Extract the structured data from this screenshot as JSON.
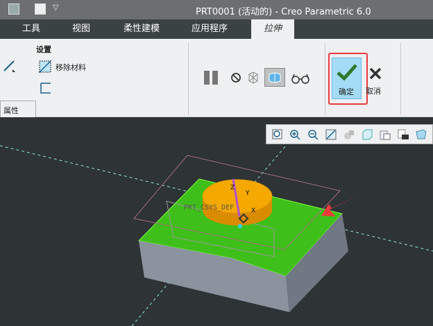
{
  "window": {
    "title": "PRT0001 (活动的) - Creo Parametric 6.0"
  },
  "tabs": [
    {
      "label": "工具"
    },
    {
      "label": "视图"
    },
    {
      "label": "柔性建模"
    },
    {
      "label": "应用程序"
    },
    {
      "label": "拉伸",
      "active": true
    }
  ],
  "ribbon": {
    "settings_label": "设置",
    "remove_material": "移除材料",
    "properties_tab": "属性",
    "ok_label": "确定",
    "cancel_label": "取消"
  },
  "view_toolbar": [
    "refit-icon",
    "zoom-in-icon",
    "zoom-out-icon",
    "repaint-icon",
    "display-style-icon",
    "saved-orientations-icon",
    "view-manager-icon",
    "screenshot-icon",
    "perspective-icon"
  ],
  "model": {
    "csys_label": "PRT_CSYS_DEF",
    "axis_labels": [
      "Z",
      "Y",
      "X"
    ]
  },
  "colors": {
    "accent": "#e83a3a",
    "green_face": "#3fbf1a",
    "extrude": "#f5a500"
  }
}
